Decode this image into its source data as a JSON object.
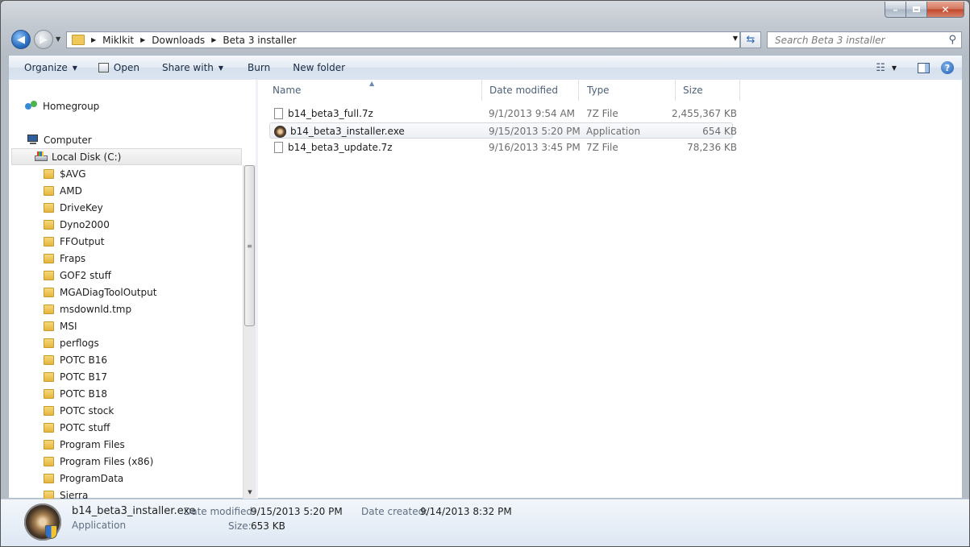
{
  "address": {
    "crumbs": [
      "Miklkit",
      "Downloads",
      "Beta 3 installer"
    ],
    "search_placeholder": "Search Beta 3 installer"
  },
  "toolbar": {
    "organize": "Organize",
    "open": "Open",
    "share_with": "Share with",
    "burn": "Burn",
    "new_folder": "New folder"
  },
  "nav": {
    "homegroup": "Homegroup",
    "computer": "Computer",
    "local_disk": "Local Disk (C:)",
    "folders": [
      "$AVG",
      "AMD",
      "DriveKey",
      "Dyno2000",
      "FFOutput",
      "Fraps",
      "GOF2 stuff",
      "MGADiagToolOutput",
      "msdownld.tmp",
      "MSI",
      "perflogs",
      "POTC B16",
      "POTC B17",
      "POTC B18",
      "POTC stock",
      "POTC stuff",
      "Program Files",
      "Program Files (x86)",
      "ProgramData",
      "Sierra"
    ]
  },
  "columns": {
    "name": "Name",
    "date_modified": "Date modified",
    "type": "Type",
    "size": "Size"
  },
  "files": [
    {
      "name": "b14_beta3_full.7z",
      "date": "9/1/2013 9:54 AM",
      "type": "7Z File",
      "size": "2,455,367 KB"
    },
    {
      "name": "b14_beta3_installer.exe",
      "date": "9/15/2013 5:20 PM",
      "type": "Application",
      "size": "654 KB"
    },
    {
      "name": "b14_beta3_update.7z",
      "date": "9/16/2013 3:45 PM",
      "type": "7Z File",
      "size": "78,236 KB"
    }
  ],
  "details": {
    "name": "b14_beta3_installer.exe",
    "type": "Application",
    "date_modified_label": "Date modified:",
    "date_modified": "9/15/2013 5:20 PM",
    "date_created_label": "Date created:",
    "date_created": "9/14/2013 8:32 PM",
    "size_label": "Size:",
    "size": "653 KB"
  },
  "colors": {
    "accent": "#2b70c4",
    "selection": "#eceff3"
  }
}
